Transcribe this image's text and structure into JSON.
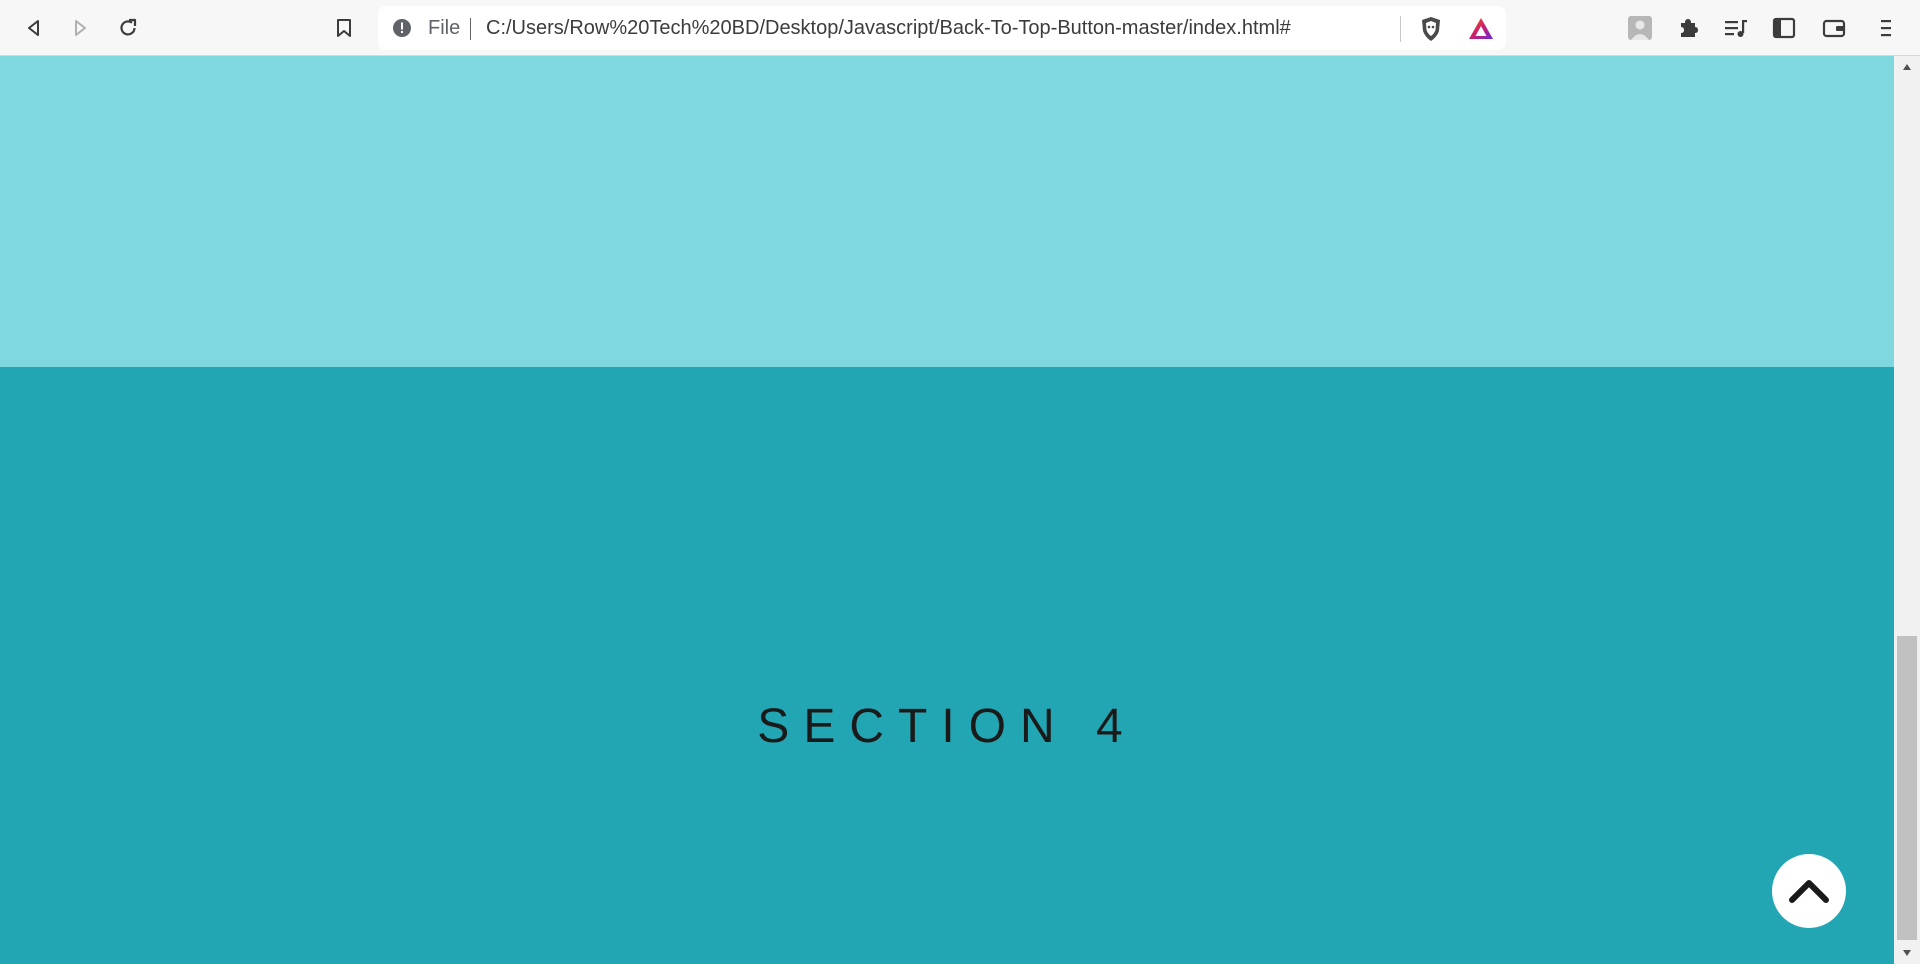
{
  "browser": {
    "scheme_label": "File",
    "url": "C:/Users/Row%20Tech%20BD/Desktop/Javascript/Back-To-Top-Button-master/index.html#",
    "icons": {
      "back": "back-icon",
      "forward": "forward-icon",
      "reload": "reload-icon",
      "bookmark": "bookmark-icon",
      "info": "info-icon",
      "shields": "brave-shields-icon",
      "rewards": "brave-rewards-icon",
      "profile": "profile-avatar-icon",
      "extensions": "puzzle-icon",
      "playlist": "playlist-icon",
      "sidebar": "sidebar-icon",
      "wallet": "wallet-icon",
      "menu": "hamburger-menu-icon"
    }
  },
  "page": {
    "section_title": "SECTION 4",
    "back_to_top_icon": "chevron-up-icon"
  },
  "colors": {
    "section_light": "#7fd8e0",
    "section_dark": "#22a6b3",
    "button_bg": "#ffffff",
    "title_text": "#1a1a1a"
  },
  "scroll": {
    "position_fraction": 0.85
  }
}
